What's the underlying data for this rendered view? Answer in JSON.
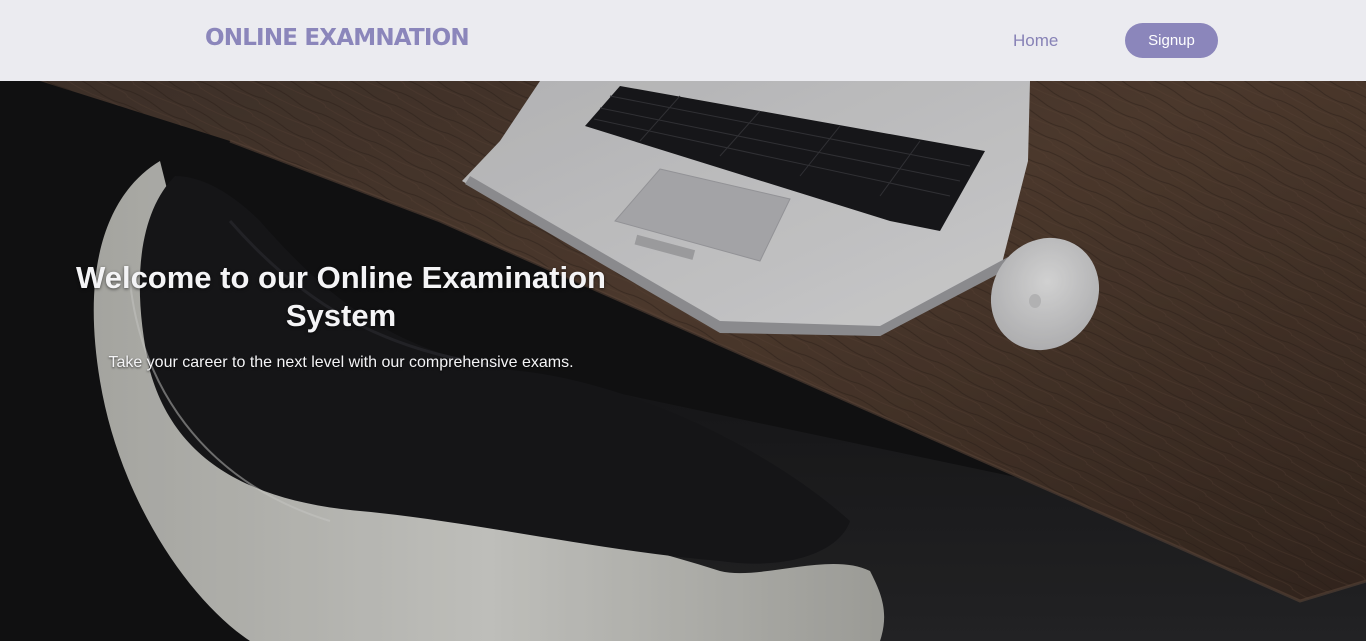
{
  "navbar": {
    "brand": "ONLINE EXAMNATION",
    "home_label": "Home",
    "signup_label": "Signup"
  },
  "hero": {
    "title": "Welcome to our Online Examination System",
    "subtitle": "Take your career to the next level with our comprehensive exams.",
    "background_image": "desk-laptop-chair-photo"
  },
  "colors": {
    "brand": "#8b86bb",
    "navbar_bg": "#ebebf0",
    "hero_text": "#f4f4f6"
  }
}
